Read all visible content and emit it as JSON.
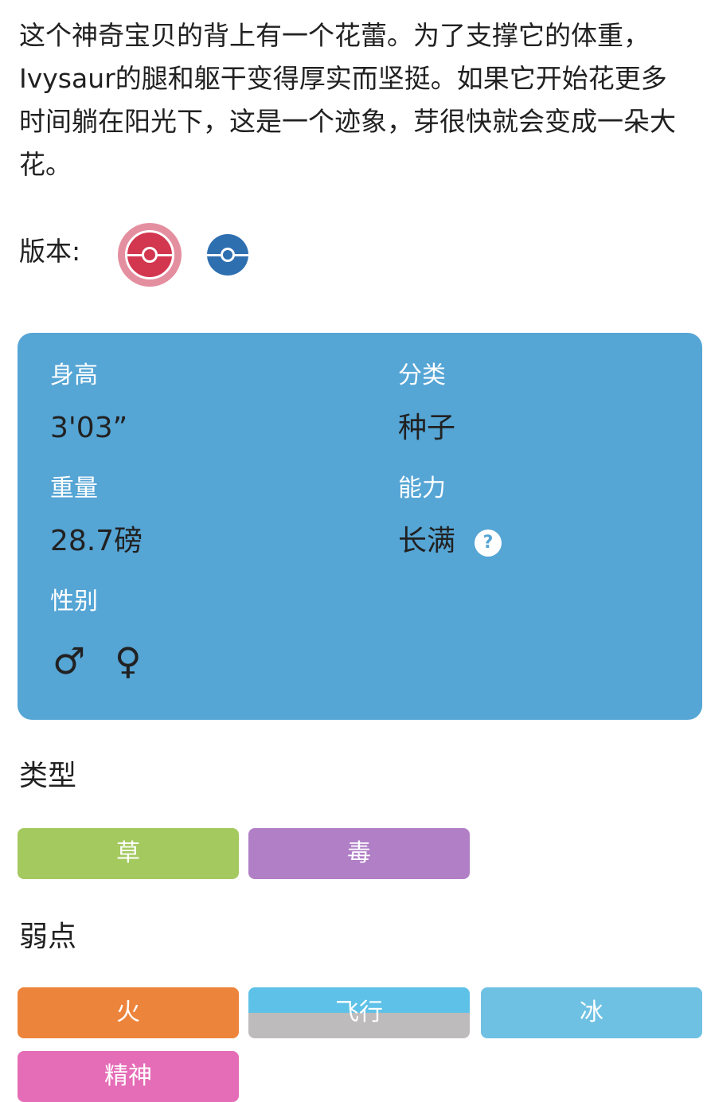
{
  "flavor_text": "这个神奇宝贝的背上有一个花蕾。为了支撑它的体重，Ivysaur的腿和躯干变得厚实而坚挺。如果它开始花更多时间躺在阳光下，这是一个迹象，芽很快就会变成一朵大花。",
  "versions": {
    "label": "版本:",
    "items": [
      {
        "name": "red-version",
        "color": "#d3364f",
        "selected": true
      },
      {
        "name": "blue-version",
        "color": "#2e6fb0",
        "selected": false
      }
    ]
  },
  "stats": {
    "background": "#55a5d5",
    "height_label": "身高",
    "height_value": "3'03”",
    "category_label": "分类",
    "category_value": "种子",
    "weight_label": "重量",
    "weight_value": "28.7磅",
    "ability_label": "能力",
    "ability_value": "长满",
    "ability_help": "?",
    "gender_label": "性别",
    "gender_male": "♂",
    "gender_female": "♀"
  },
  "types": {
    "title": "类型",
    "items": [
      {
        "label": "草",
        "color": "#a4c95f"
      },
      {
        "label": "毒",
        "color": "#b07fc6"
      }
    ]
  },
  "weaknesses": {
    "title": "弱点",
    "items": [
      {
        "label": "火",
        "color": "#ed843b"
      },
      {
        "label": "飞行",
        "color_top": "#5ec1e8",
        "color_bottom": "#bdbbbb"
      },
      {
        "label": "冰",
        "color": "#6fc1e3"
      },
      {
        "label": "精神",
        "color": "#e56cb6"
      }
    ]
  }
}
